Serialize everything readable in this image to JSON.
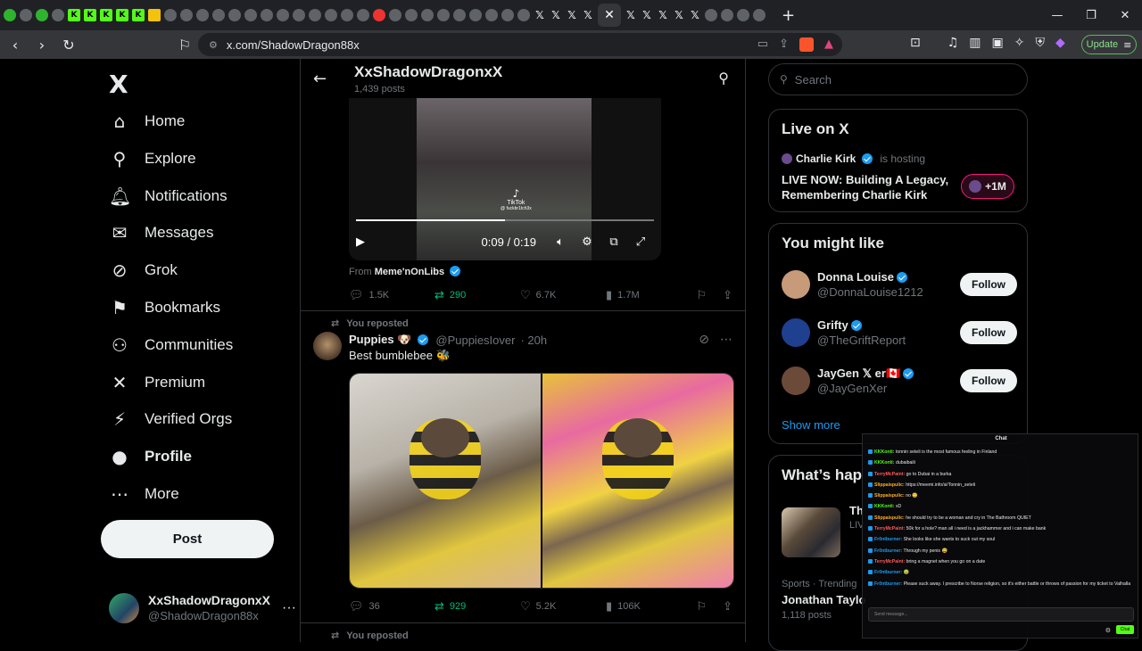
{
  "browser": {
    "tabs_count_label": "",
    "new_tab": "+",
    "window_controls": [
      "—",
      "❐",
      "✕"
    ],
    "url": "x.com/ShadowDragon88x",
    "update_label": "Update"
  },
  "nav": {
    "logo": "X",
    "items": [
      {
        "label": "Home",
        "icon": "home-icon",
        "glyph": "⌂"
      },
      {
        "label": "Explore",
        "icon": "search-icon",
        "glyph": "⚲"
      },
      {
        "label": "Notifications",
        "icon": "bell-icon",
        "glyph": "🔔︎"
      },
      {
        "label": "Messages",
        "icon": "envelope-icon",
        "glyph": "✉"
      },
      {
        "label": "Grok",
        "icon": "grok-icon",
        "glyph": "⊘"
      },
      {
        "label": "Bookmarks",
        "icon": "bookmark-icon",
        "glyph": "⚑"
      },
      {
        "label": "Communities",
        "icon": "people-icon",
        "glyph": "⚇"
      },
      {
        "label": "Premium",
        "icon": "x-icon",
        "glyph": "✕"
      },
      {
        "label": "Verified Orgs",
        "icon": "lightning-icon",
        "glyph": "⚡"
      },
      {
        "label": "Profile",
        "icon": "person-icon",
        "glyph": "●"
      },
      {
        "label": "More",
        "icon": "more-icon",
        "glyph": "⋯"
      }
    ],
    "post_label": "Post",
    "account_name": "XxShadowDragonxX",
    "account_handle": "@ShadowDragon88x",
    "account_menu": "···"
  },
  "profile_header": {
    "title": "XxShadowDragonxX",
    "posts": "1,439 posts"
  },
  "video_tweet": {
    "tiktok_label": "TikTok",
    "tiktok_handle": "@ fuckbr1tch3x",
    "time": "0:09 / 0:19",
    "progress": 0.5,
    "from_prefix": "From",
    "from_name": "Meme'nOnLibs",
    "replies": "1.5K",
    "reposts": "290",
    "likes": "6.7K",
    "views": "1.7M"
  },
  "repost_tweet": {
    "reposted_label": "You reposted",
    "name": "Puppies 🐶",
    "handle": "@PuppiesIover",
    "time": "· 20h",
    "text": "Best bumblebee 🐝",
    "replies": "36",
    "reposts": "929",
    "likes": "5.2K",
    "views": "106K"
  },
  "next_reposted_label": "You reposted",
  "right": {
    "search_placeholder": "Search",
    "live_title": "Live on X",
    "live_host": "Charlie Kirk",
    "live_host_suffix": "is hosting",
    "live_stream_title": "LIVE NOW: Building A Legacy, Remembering Charlie Kirk",
    "live_count": "+1M",
    "suggestions_title": "You might like",
    "suggestions": [
      {
        "name": "Donna Louise",
        "handle": "@DonnaLouise1212",
        "button": "Follow",
        "color": "#c79a7a"
      },
      {
        "name": "Grifty",
        "handle": "@TheGriftReport",
        "button": "Follow",
        "color": "#1f3f8f"
      },
      {
        "name": "JayGen 𝕏 er🇨🇦",
        "handle": "@JayGenXer",
        "button": "Follow",
        "color": "#6b4a3a"
      }
    ],
    "show_more": "Show more",
    "whats_happening": "What’s hap",
    "trend1_title": "Th",
    "trend1_label": "LIV",
    "trend2_category": "Sports · Trending",
    "trend2_title": "Jonathan Taylo",
    "trend2_posts": "1,118 posts"
  },
  "chat": {
    "title": "Chat",
    "lines": [
      {
        "user": "KKKonti:",
        "color": "#53fc18",
        "text": "tonnin seteli is the most famous feeling in Finland"
      },
      {
        "user": "KKKonti:",
        "color": "#53fc18",
        "text": "dubaibaili"
      },
      {
        "user": "TerryMcPaint:",
        "color": "#ff5a5a",
        "text": "go to Dubai in a burka"
      },
      {
        "user": "Slippaispulic:",
        "color": "#ffb020",
        "text": "https://meemi.info/si/Tonnin_seteli"
      },
      {
        "user": "Slippaispulic:",
        "color": "#ffb020",
        "text": "no 😑"
      },
      {
        "user": "KKKonti:",
        "color": "#53fc18",
        "text": "xD"
      },
      {
        "user": "Slippaispulic:",
        "color": "#ffb020",
        "text": "he should try to be a woman and cry in The Bathroom QUIET"
      },
      {
        "user": "TerryMcPaint:",
        "color": "#ff5a5a",
        "text": "50k for a hole? man all i need is a jackhammer and i can make bank"
      },
      {
        "user": "Fr0ntburner:",
        "color": "#1d9bf0",
        "text": "She looks like she wants to suck out my soul"
      },
      {
        "user": "Fr0ntburner:",
        "color": "#1d9bf0",
        "text": "Through my penis 😅"
      },
      {
        "user": "TerryMcPaint:",
        "color": "#ff5a5a",
        "text": "bring a magnet when you go on a date"
      },
      {
        "user": "Fr0ntburner:",
        "color": "#1d9bf0",
        "text": "🤢"
      },
      {
        "user": "Fr0ntburner:",
        "color": "#1d9bf0",
        "text": "Please suck away. I prescribe to Norse religion, so it's either battle or throws of passion for my ticket to Valhalla"
      }
    ],
    "input_placeholder": "Send message...",
    "send_label": "Chat"
  }
}
